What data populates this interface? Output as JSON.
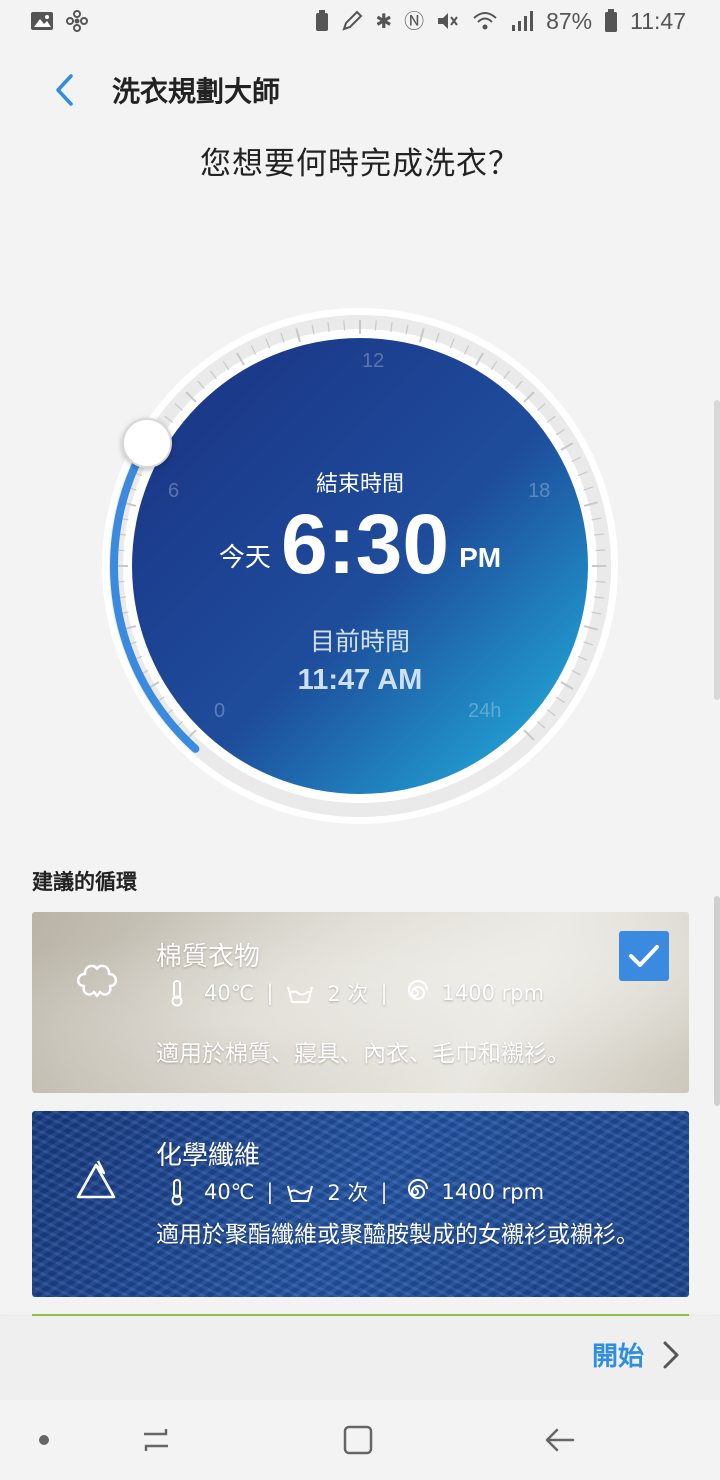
{
  "status_bar": {
    "battery_percent": "87%",
    "time": "11:47"
  },
  "header": {
    "title": "洗衣規劃大師"
  },
  "question": "您想要何時完成洗衣？",
  "dial": {
    "end_label": "結束時間",
    "day": "今天",
    "end_time": "6:30",
    "end_ampm": "PM",
    "current_label": "目前時間",
    "current_time": "11:47 AM",
    "ticks": {
      "top": "12",
      "left": "6",
      "right": "18",
      "bottom_left": "0",
      "bottom_right": "24h"
    }
  },
  "suggestions": {
    "title": "建議的循環",
    "cards": [
      {
        "name": "棉質衣物",
        "temperature": "40℃",
        "rinse": "2 次",
        "spin": "1400 rpm",
        "description": "適用於棉質、寢具、內衣、毛巾和襯衫。",
        "selected": true
      },
      {
        "name": "化學纖維",
        "temperature": "40℃",
        "rinse": "2 次",
        "spin": "1400 rpm",
        "description": "適用於聚酯纖維或聚醯胺製成的女襯衫或襯衫。",
        "selected": false
      }
    ]
  },
  "action": {
    "start_label": "開始"
  },
  "colors": {
    "accent": "#2f8ee0",
    "dial_dark": "#1d3f8f",
    "dial_light": "#22a6d6",
    "progress": "#3a8be0"
  }
}
